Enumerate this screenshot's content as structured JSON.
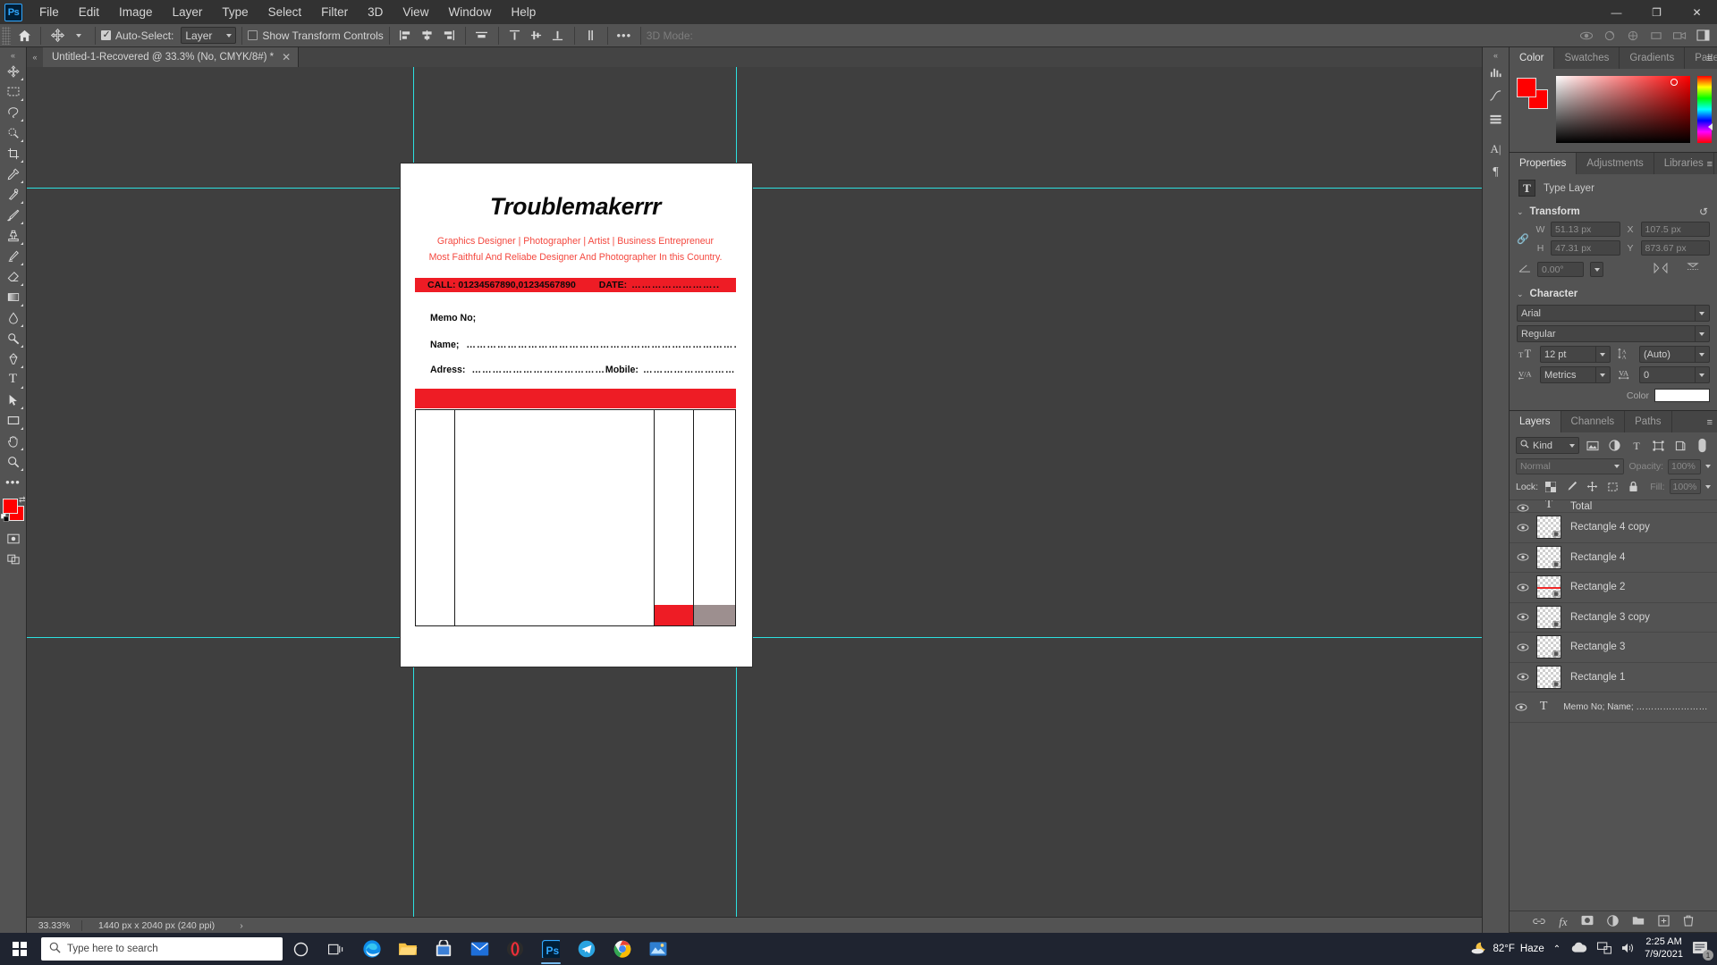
{
  "app": {
    "name": "Adobe Photoshop",
    "logo": "Ps"
  },
  "menubar": {
    "items": [
      "File",
      "Edit",
      "Image",
      "Layer",
      "Type",
      "Select",
      "Filter",
      "3D",
      "View",
      "Window",
      "Help"
    ]
  },
  "window_controls": {
    "minimize": "—",
    "maximize": "❐",
    "close": "✕"
  },
  "options_bar": {
    "home_icon": "home-icon",
    "tool_icon": "move-tool-icon",
    "auto_select_label": "Auto-Select:",
    "auto_select_checked": true,
    "auto_select_scope": "Layer",
    "show_transform_label": "Show Transform Controls",
    "show_transform_checked": false,
    "more_label": "•••",
    "mode_3d_label": "3D Mode:"
  },
  "toolbar": {
    "collapse": "«",
    "tools": [
      "move-tool",
      "marquee-tool",
      "lasso-tool",
      "quick-select-tool",
      "crop-tool",
      "eyedropper-tool",
      "spot-healing-tool",
      "brush-tool",
      "clone-stamp-tool",
      "history-brush-tool",
      "eraser-tool",
      "gradient-tool",
      "blur-tool",
      "dodge-tool",
      "pen-tool",
      "type-tool",
      "path-select-tool",
      "rectangle-tool",
      "hand-tool",
      "zoom-tool",
      "more-tools",
      "edit-toolbar"
    ],
    "foreground_color": "#ff0000",
    "background_color": "#ff0000",
    "quickmask": "quick-mask-icon",
    "screenmode": "screen-mode-icon"
  },
  "document_tab": {
    "title": "Untitled-1-Recovered @ 33.3% (No, CMYK/8#) *",
    "close": "✕"
  },
  "document": {
    "title": "Troublemakerrr",
    "subtitle_1": "Graphics Designer | Photographer | Artist | Business Entrepreneur",
    "subtitle_2": "Most Faithful And Reliabe Designer And Photographer In this Country.",
    "call_line": "CALL: 01234567890,01234567890",
    "date_label": "DATE:",
    "date_dots": "……………………..",
    "memo_label": "Memo No;",
    "name_label": "Name;",
    "name_dots": "……………………………………………………………………………",
    "address_label": "Adress:",
    "address_dots": "…………………………………",
    "mobile_label": "Mobile:",
    "mobile_dots": "……………………………………",
    "accent_red": "#ee1c25",
    "subtitle_red": "#f4483f",
    "total_cell_color": "#ee1c25",
    "total_value_color": "#9d8f8f"
  },
  "color_panel": {
    "tabs": [
      "Color",
      "Swatches",
      "Gradients",
      "Patterns"
    ],
    "active_tab": "Color",
    "menu": "≡",
    "foreground": "#ff0000",
    "background": "#ff0000"
  },
  "properties_panel": {
    "tabs": [
      "Properties",
      "Adjustments",
      "Libraries"
    ],
    "active_tab": "Properties",
    "menu": "≡",
    "layer_type_icon": "T",
    "layer_type_label": "Type Layer",
    "transform": {
      "section_label": "Transform",
      "reset_icon": "reset-icon",
      "w_label": "W",
      "w_value": "51.13 px",
      "h_label": "H",
      "h_value": "47.31 px",
      "x_label": "X",
      "x_value": "107.5 px",
      "y_label": "Y",
      "y_value": "873.67 px",
      "angle_value": "0.00°"
    },
    "character": {
      "section_label": "Character",
      "font_family": "Arial",
      "font_style": "Regular",
      "font_size": "12 pt",
      "leading": "(Auto)",
      "kerning": "Metrics",
      "tracking": "0",
      "color_label": "Color",
      "color_value": "#ffffff"
    }
  },
  "layers_panel": {
    "tabs": [
      "Layers",
      "Channels",
      "Paths"
    ],
    "active_tab": "Layers",
    "menu": "≡",
    "filter_kind": "Kind",
    "filter_icons": [
      "pixel-filter-icon",
      "adjustment-filter-icon",
      "type-filter-icon",
      "shape-filter-icon",
      "smart-object-filter-icon"
    ],
    "blend_mode": "Normal",
    "opacity_label": "Opacity:",
    "opacity_value": "100%",
    "lock_label": "Lock:",
    "lock_icons": [
      "lock-transparent-icon",
      "lock-image-icon",
      "lock-position-icon",
      "lock-artboard-icon",
      "lock-all-icon"
    ],
    "fill_label": "Fill:",
    "fill_value": "100%",
    "layers": [
      {
        "name": "Total",
        "type": "text",
        "visible": true,
        "partial": true
      },
      {
        "name": "Rectangle 4 copy",
        "type": "shape",
        "visible": true
      },
      {
        "name": "Rectangle 4",
        "type": "shape",
        "visible": true
      },
      {
        "name": "Rectangle 2",
        "type": "shape",
        "visible": true,
        "has_red": true
      },
      {
        "name": "Rectangle 3 copy",
        "type": "shape",
        "visible": true
      },
      {
        "name": "Rectangle 3",
        "type": "shape",
        "visible": true
      },
      {
        "name": "Rectangle 1",
        "type": "shape",
        "visible": true
      },
      {
        "name": "Memo No;  Name;  ……………………………",
        "type": "text",
        "visible": true
      }
    ],
    "footer_icons": [
      "link-layers-icon",
      "layer-style-fx-icon",
      "add-mask-icon",
      "adjustment-layer-icon",
      "new-group-icon",
      "new-layer-icon",
      "delete-layer-icon"
    ]
  },
  "status_bar": {
    "zoom": "33.33%",
    "doc_size": "1440 px x 2040 px (240 ppi)",
    "arrow": "›"
  },
  "taskbar": {
    "search_placeholder": "Type here to search",
    "search_icon": "search-icon",
    "apps": [
      "cortana-icon",
      "task-view-icon",
      "edge-icon",
      "file-explorer-icon",
      "store-icon",
      "mail-icon",
      "opera-gx-icon",
      "photoshop-icon",
      "telegram-icon",
      "chrome-icon",
      "photos-icon"
    ],
    "weather_temp": "82°F",
    "weather_desc": "Haze",
    "time": "2:25 AM",
    "date": "7/9/2021",
    "notification_count": "1"
  }
}
